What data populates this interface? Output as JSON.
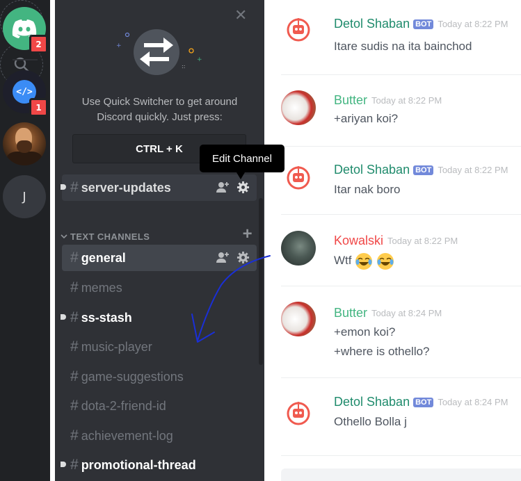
{
  "servers": {
    "home_badge": "2",
    "dev_badge": "1",
    "dev_icon_text": "</>",
    "j_label": "J",
    "add_icon": "plus-icon",
    "search_icon": "search-icon"
  },
  "quick_switcher": {
    "line1": "Use Quick Switcher to get around",
    "line2": "Discord quickly. Just press:",
    "shortcut": "CTRL + K"
  },
  "tooltip": "Edit Channel",
  "category": "TEXT CHANNELS",
  "channels": [
    {
      "name": "server-updates",
      "state": "unread"
    },
    {
      "name": "general",
      "state": "active"
    },
    {
      "name": "memes",
      "state": "read"
    },
    {
      "name": "ss-stash",
      "state": "unread"
    },
    {
      "name": "music-player",
      "state": "read"
    },
    {
      "name": "game-suggestions",
      "state": "read"
    },
    {
      "name": "dota-2-friend-id",
      "state": "read"
    },
    {
      "name": "achievement-log",
      "state": "read"
    },
    {
      "name": "promotional-thread",
      "state": "unread"
    }
  ],
  "bot_tag": "BOT",
  "messages": [
    {
      "author": "Detol Shaban",
      "bot": true,
      "time": "Today at 8:22 PM",
      "lines": [
        "Itare sudis na ita bainchod"
      ]
    },
    {
      "author": "Butter",
      "bot": false,
      "time": "Today at 8:22 PM",
      "lines": [
        "+ariyan koi?"
      ]
    },
    {
      "author": "Detol Shaban",
      "bot": true,
      "time": "Today at 8:22 PM",
      "lines": [
        "Itar nak boro"
      ]
    },
    {
      "author": "Kowalski",
      "bot": false,
      "time": "Today at 8:22 PM",
      "lines": [
        "Wtf"
      ]
    },
    {
      "author": "Butter",
      "bot": false,
      "time": "Today at 8:24 PM",
      "lines": [
        "+emon koi?",
        "+where is othello?"
      ]
    },
    {
      "author": "Detol Shaban",
      "bot": true,
      "time": "Today at 8:24 PM",
      "lines": [
        "Othello Bolla j"
      ]
    }
  ],
  "colors": {
    "rail": "#202225",
    "sidebar": "#2f3136",
    "accent": "#7289da",
    "online": "#43b581",
    "danger": "#f04747"
  }
}
